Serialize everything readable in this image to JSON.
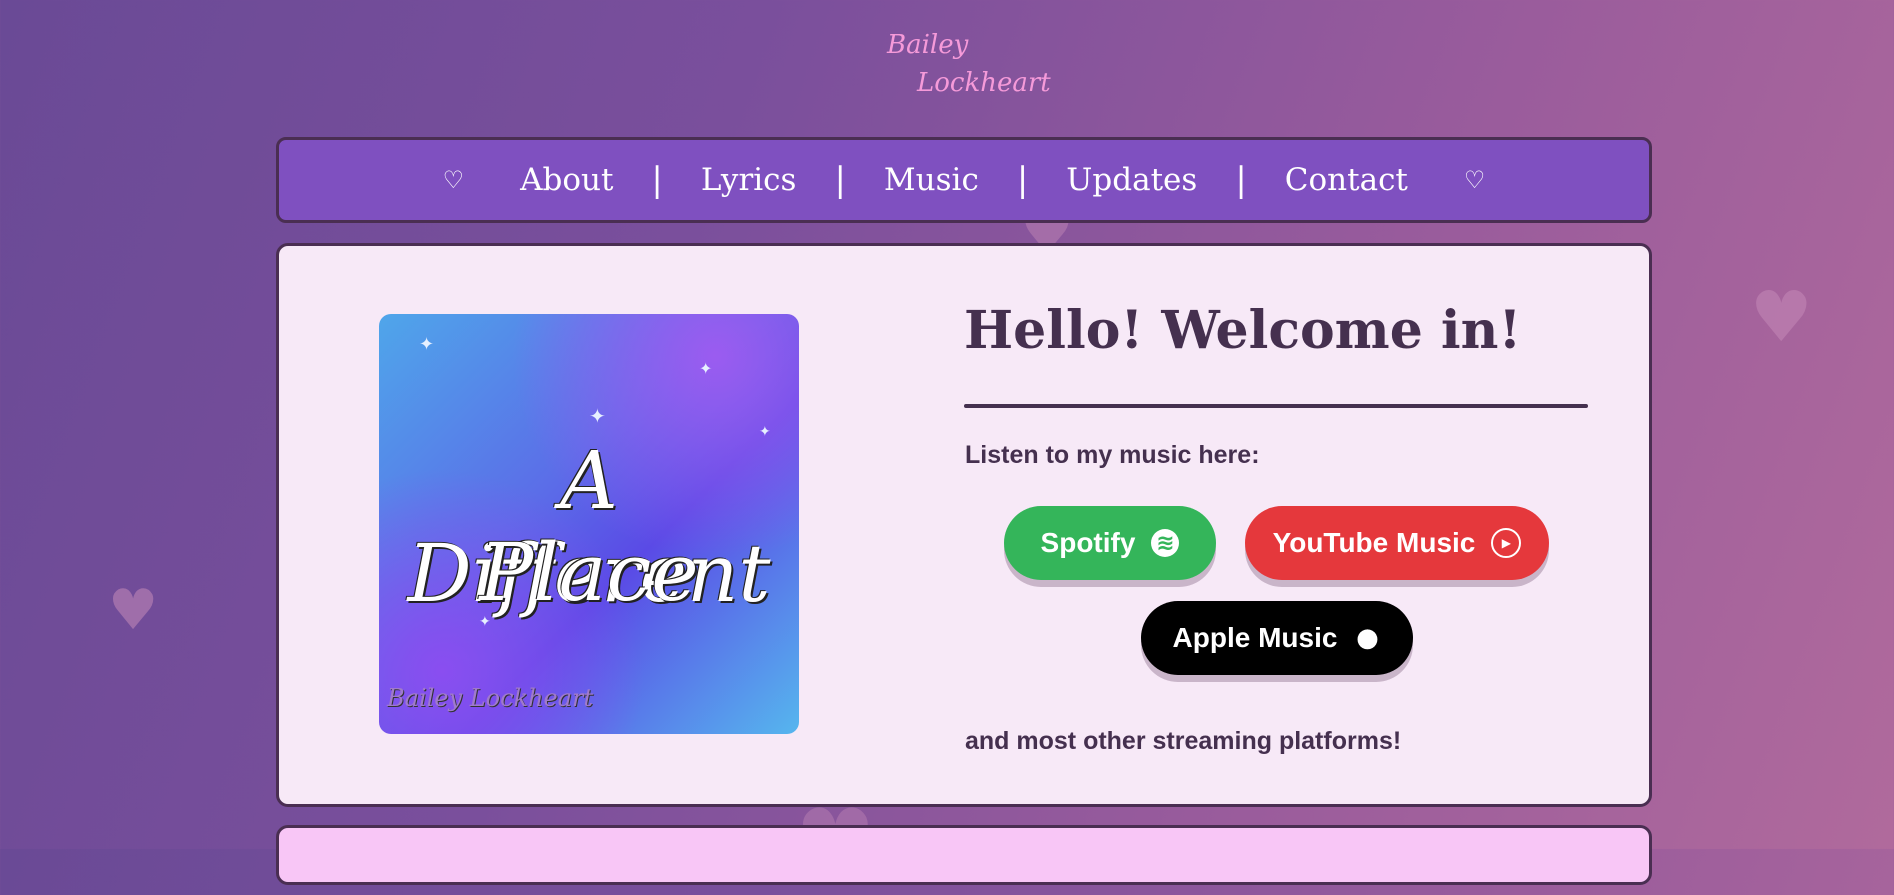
{
  "logo": {
    "line1": "Bailey",
    "line2": "Lockheart"
  },
  "nav": {
    "heart": "♡",
    "separator": "|",
    "items": [
      "About",
      "Lyrics",
      "Music",
      "Updates",
      "Contact"
    ]
  },
  "cover": {
    "line1": "A Different",
    "line2": "Place",
    "signature": "Bailey Lockheart"
  },
  "main": {
    "greeting": "Hello! Welcome in!",
    "listen_label": "Listen to my music here:",
    "buttons": {
      "spotify": {
        "label": "Spotify",
        "icon": "spotify-icon",
        "color": "#34b55a"
      },
      "youtube": {
        "label": "YouTube Music",
        "icon": "youtube-music-icon",
        "color": "#e5383c"
      },
      "apple": {
        "label": "Apple Music",
        "icon": "apple-icon",
        "color": "#000000"
      }
    },
    "other_platforms": "and most other streaming platforms!"
  },
  "colors": {
    "nav_bg": "#7f50c0",
    "card_bg": "#f7e9f7",
    "text_dark": "#45304f",
    "logo_pink": "#f59ad9"
  }
}
